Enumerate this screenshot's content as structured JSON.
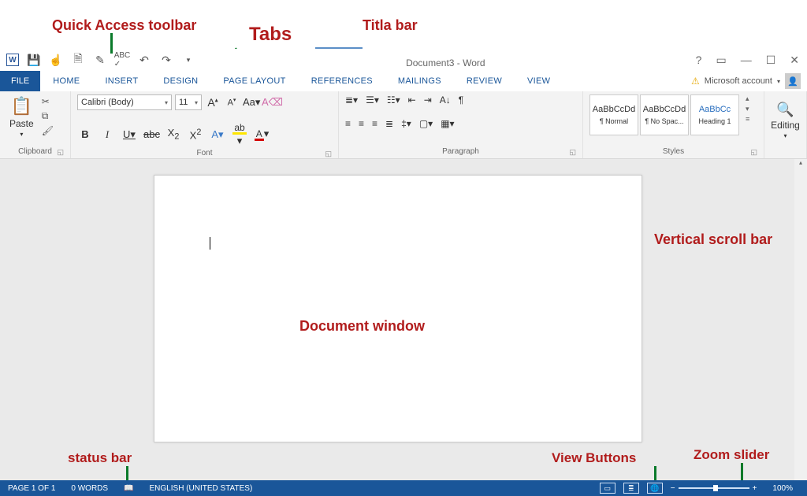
{
  "annotations": {
    "qat": "Quick Access toolbar",
    "tabs": "Tabs",
    "title_bar": "Titla bar",
    "document_window": "Document window",
    "vertical_scroll": "Vertical scroll bar",
    "status_bar": "status bar",
    "view_buttons": "View Buttons",
    "zoom_slider": "Zoom slider"
  },
  "titlebar": {
    "title": "Document3 - Word"
  },
  "tabs": {
    "file": "FILE",
    "items": [
      "HOME",
      "INSERT",
      "DESIGN",
      "PAGE LAYOUT",
      "REFERENCES",
      "MAILINGS",
      "REVIEW",
      "VIEW"
    ],
    "active": "HOME"
  },
  "account": {
    "label": "Microsoft account"
  },
  "ribbon": {
    "clipboard": {
      "label": "Clipboard",
      "paste": "Paste"
    },
    "font": {
      "label": "Font",
      "family": "Calibri (Body)",
      "size": "11"
    },
    "paragraph": {
      "label": "Paragraph"
    },
    "styles": {
      "label": "Styles",
      "tiles": [
        {
          "preview": "AaBbCcDd",
          "name": "¶ Normal"
        },
        {
          "preview": "AaBbCcDd",
          "name": "¶ No Spac..."
        },
        {
          "preview": "AaBbCc",
          "name": "Heading 1"
        }
      ]
    },
    "editing": {
      "label": "Editing"
    }
  },
  "statusbar": {
    "page": "PAGE 1 OF 1",
    "words": "0 WORDS",
    "language": "ENGLISH (UNITED STATES)",
    "zoom": "100%"
  }
}
